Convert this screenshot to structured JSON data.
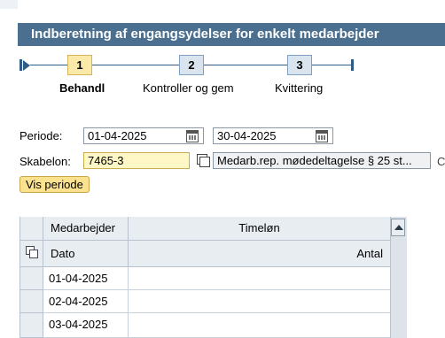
{
  "title": "Indberetning af engangsydelser for enkelt medarbejder",
  "roadmap": {
    "steps": [
      {
        "number": "1",
        "label": "Behandl",
        "active": true
      },
      {
        "number": "2",
        "label": "Kontroller og gem",
        "active": false
      },
      {
        "number": "3",
        "label": "Kvittering",
        "active": false
      }
    ]
  },
  "form": {
    "periode_label": "Periode:",
    "periode_from": "01-04-2025",
    "periode_to": "30-04-2025",
    "skabelon_label": "Skabelon:",
    "skabelon_value": "7465-3",
    "skabelon_description": "Medarb.rep. mødedeltagelse § 25 st...",
    "trailing_char": "C",
    "vis_periode_button": "Vis periode"
  },
  "table": {
    "header_row1": {
      "col1": "Medarbejder",
      "col2": "Timeløn"
    },
    "header_row2": {
      "col1": "Dato",
      "col2": "Antal"
    },
    "rows": [
      {
        "dato": "01-04-2025",
        "antal": ""
      },
      {
        "dato": "02-04-2025",
        "antal": ""
      },
      {
        "dato": "03-04-2025",
        "antal": ""
      }
    ]
  },
  "icons": [
    "calendar-icon",
    "copy-icon",
    "select-all-icon",
    "scroll-up-icon"
  ],
  "colors": {
    "title_bar": "#4a6f8f",
    "active_step": "#fbe9a9",
    "button": "#fbe28e",
    "yellow_field": "#fff8c6"
  }
}
